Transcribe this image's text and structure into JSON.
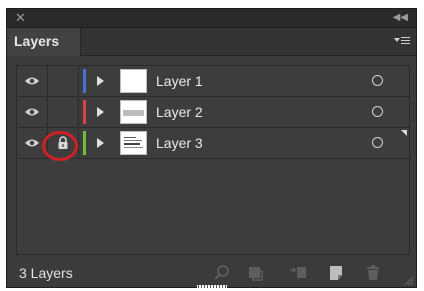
{
  "window": {
    "close_icon": "close-icon",
    "collapse_icon": "collapse-panel-icon"
  },
  "panel": {
    "tab_title": "Layers",
    "menu_icon": "panel-menu-icon"
  },
  "layers": [
    {
      "name": "Layer 1",
      "color": "#4a6fd1",
      "visible": true,
      "locked": false,
      "selected": false
    },
    {
      "name": "Layer 2",
      "color": "#d64545",
      "visible": true,
      "locked": false,
      "selected": false
    },
    {
      "name": "Layer 3",
      "color": "#6fbf3d",
      "visible": true,
      "locked": true,
      "selected": true
    }
  ],
  "footer": {
    "layer_count": "3 Layers",
    "buttons": [
      "locate-object-icon",
      "make-clipping-mask-icon",
      "create-sublayer-icon",
      "create-new-layer-icon",
      "delete-layer-icon"
    ]
  },
  "annotation": {
    "highlight_color": "#d21f25"
  }
}
